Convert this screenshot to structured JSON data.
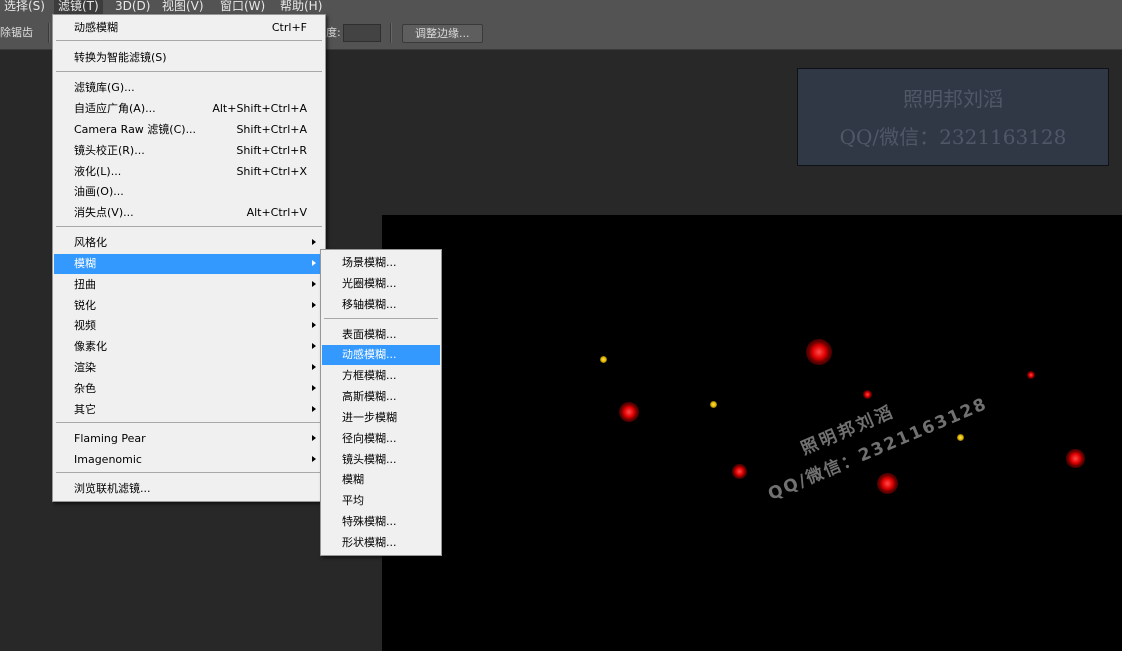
{
  "menubar": {
    "items": [
      {
        "label": "选择(S)"
      },
      {
        "label": "滤镜(T)"
      },
      {
        "label": "3D(D)"
      },
      {
        "label": "视图(V)"
      },
      {
        "label": "窗口(W)"
      },
      {
        "label": "帮助(H)"
      }
    ]
  },
  "options_bar": {
    "left_label": "除锯齿",
    "field_label": "度:",
    "refine_edge_button": "调整边缘..."
  },
  "filter_menu": {
    "last_filter": {
      "label": "动感模糊",
      "shortcut": "Ctrl+F"
    },
    "smart_filter": {
      "label": "转换为智能滤镜(S)"
    },
    "gallery": {
      "label": "滤镜库(G)..."
    },
    "adaptive_wide_angle": {
      "label": "自适应广角(A)...",
      "shortcut": "Alt+Shift+Ctrl+A"
    },
    "camera_raw": {
      "label": "Camera Raw 滤镜(C)...",
      "shortcut": "Shift+Ctrl+A"
    },
    "lens_correction": {
      "label": "镜头校正(R)...",
      "shortcut": "Shift+Ctrl+R"
    },
    "liquify": {
      "label": "液化(L)...",
      "shortcut": "Shift+Ctrl+X"
    },
    "oil_paint": {
      "label": "油画(O)..."
    },
    "vanishing_point": {
      "label": "消失点(V)...",
      "shortcut": "Alt+Ctrl+V"
    },
    "stylize": {
      "label": "风格化"
    },
    "blur": {
      "label": "模糊"
    },
    "distort": {
      "label": "扭曲"
    },
    "sharpen": {
      "label": "锐化"
    },
    "video": {
      "label": "视频"
    },
    "pixelate": {
      "label": "像素化"
    },
    "render": {
      "label": "渲染"
    },
    "noise": {
      "label": "杂色"
    },
    "other": {
      "label": "其它"
    },
    "flaming_pear": {
      "label": "Flaming Pear"
    },
    "imagenomic": {
      "label": "Imagenomic"
    },
    "browse_online": {
      "label": "浏览联机滤镜..."
    }
  },
  "blur_submenu": {
    "items": [
      {
        "label": "场景模糊..."
      },
      {
        "label": "光圈模糊..."
      },
      {
        "label": "移轴模糊..."
      },
      {
        "label": "表面模糊..."
      },
      {
        "label": "动感模糊..."
      },
      {
        "label": "方框模糊..."
      },
      {
        "label": "高斯模糊..."
      },
      {
        "label": "进一步模糊"
      },
      {
        "label": "径向模糊..."
      },
      {
        "label": "镜头模糊..."
      },
      {
        "label": "模糊"
      },
      {
        "label": "平均"
      },
      {
        "label": "特殊模糊..."
      },
      {
        "label": "形状模糊..."
      }
    ],
    "highlighted_index": 4
  },
  "watermark": {
    "name": "照明邦刘滔",
    "contact": "QQ/微信：2321163128",
    "contact_canvas": "QQ/微信：2321163128"
  },
  "colors": {
    "highlight": "#3399ff",
    "menu_bg": "#f0f0f0",
    "dot_red": "#e00000",
    "dot_yellow": "#e3b800"
  }
}
